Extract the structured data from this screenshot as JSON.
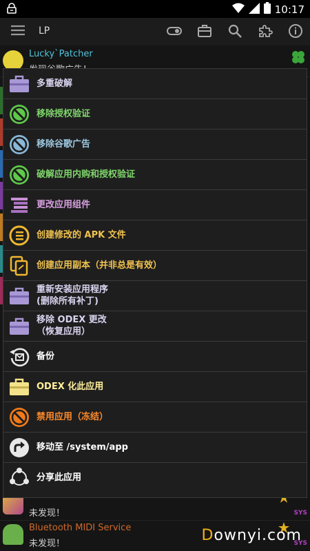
{
  "status": {
    "time": "10:17"
  },
  "actionbar": {
    "title": "LP"
  },
  "background": {
    "rows": [
      {
        "title": "Lucky`Patcher",
        "subtitle": "发现谷歌广告！"
      },
      {
        "title": "",
        "subtitle": "未发现！"
      },
      {
        "title": "Bluetooth MIDI Service",
        "subtitle": "未发现！"
      }
    ],
    "sys_badge": "SYS"
  },
  "menu": {
    "items": [
      {
        "label": "多重破解",
        "color": "#d9d3ef",
        "icon": "toolbox-icon"
      },
      {
        "label": "移除授权验证",
        "color": "#7fd66b",
        "icon": "no-license-icon"
      },
      {
        "label": "移除谷歌广告",
        "color": "#9ec9e2",
        "icon": "no-ads-icon"
      },
      {
        "label": "破解应用内购和授权验证",
        "color": "#7fd66b",
        "icon": "no-billing-icon"
      },
      {
        "label": "更改应用组件",
        "color": "#d7a0df",
        "icon": "components-icon"
      },
      {
        "label": "创建修改的 APK 文件",
        "color": "#f0c24f",
        "icon": "create-apk-icon"
      },
      {
        "label": "创建应用副本（并非总是有效）",
        "color": "#f0c24f",
        "icon": "clone-app-icon"
      },
      {
        "label": "重新安装应用程序",
        "label2": "(删除所有补丁)",
        "color": "#d9d3ef",
        "icon": "reinstall-icon"
      },
      {
        "label": "移除 ODEX 更改",
        "label2": "（恢复应用）",
        "color": "#d9d3ef",
        "icon": "remove-odex-icon"
      },
      {
        "label": "备份",
        "color": "#ffffff",
        "icon": "backup-icon"
      },
      {
        "label": "ODEX 化此应用",
        "color": "#ffef9a",
        "icon": "odex-icon"
      },
      {
        "label": "禁用应用（冻结）",
        "color": "#ff8a2a",
        "icon": "freeze-icon"
      },
      {
        "label": "移动至 /system/app",
        "color": "#ffffff",
        "icon": "move-system-icon"
      },
      {
        "label": "分享此应用",
        "color": "#ffffff",
        "icon": "share-icon"
      }
    ]
  },
  "watermark": {
    "prefix": "D",
    "rest": "ownyi.com"
  }
}
